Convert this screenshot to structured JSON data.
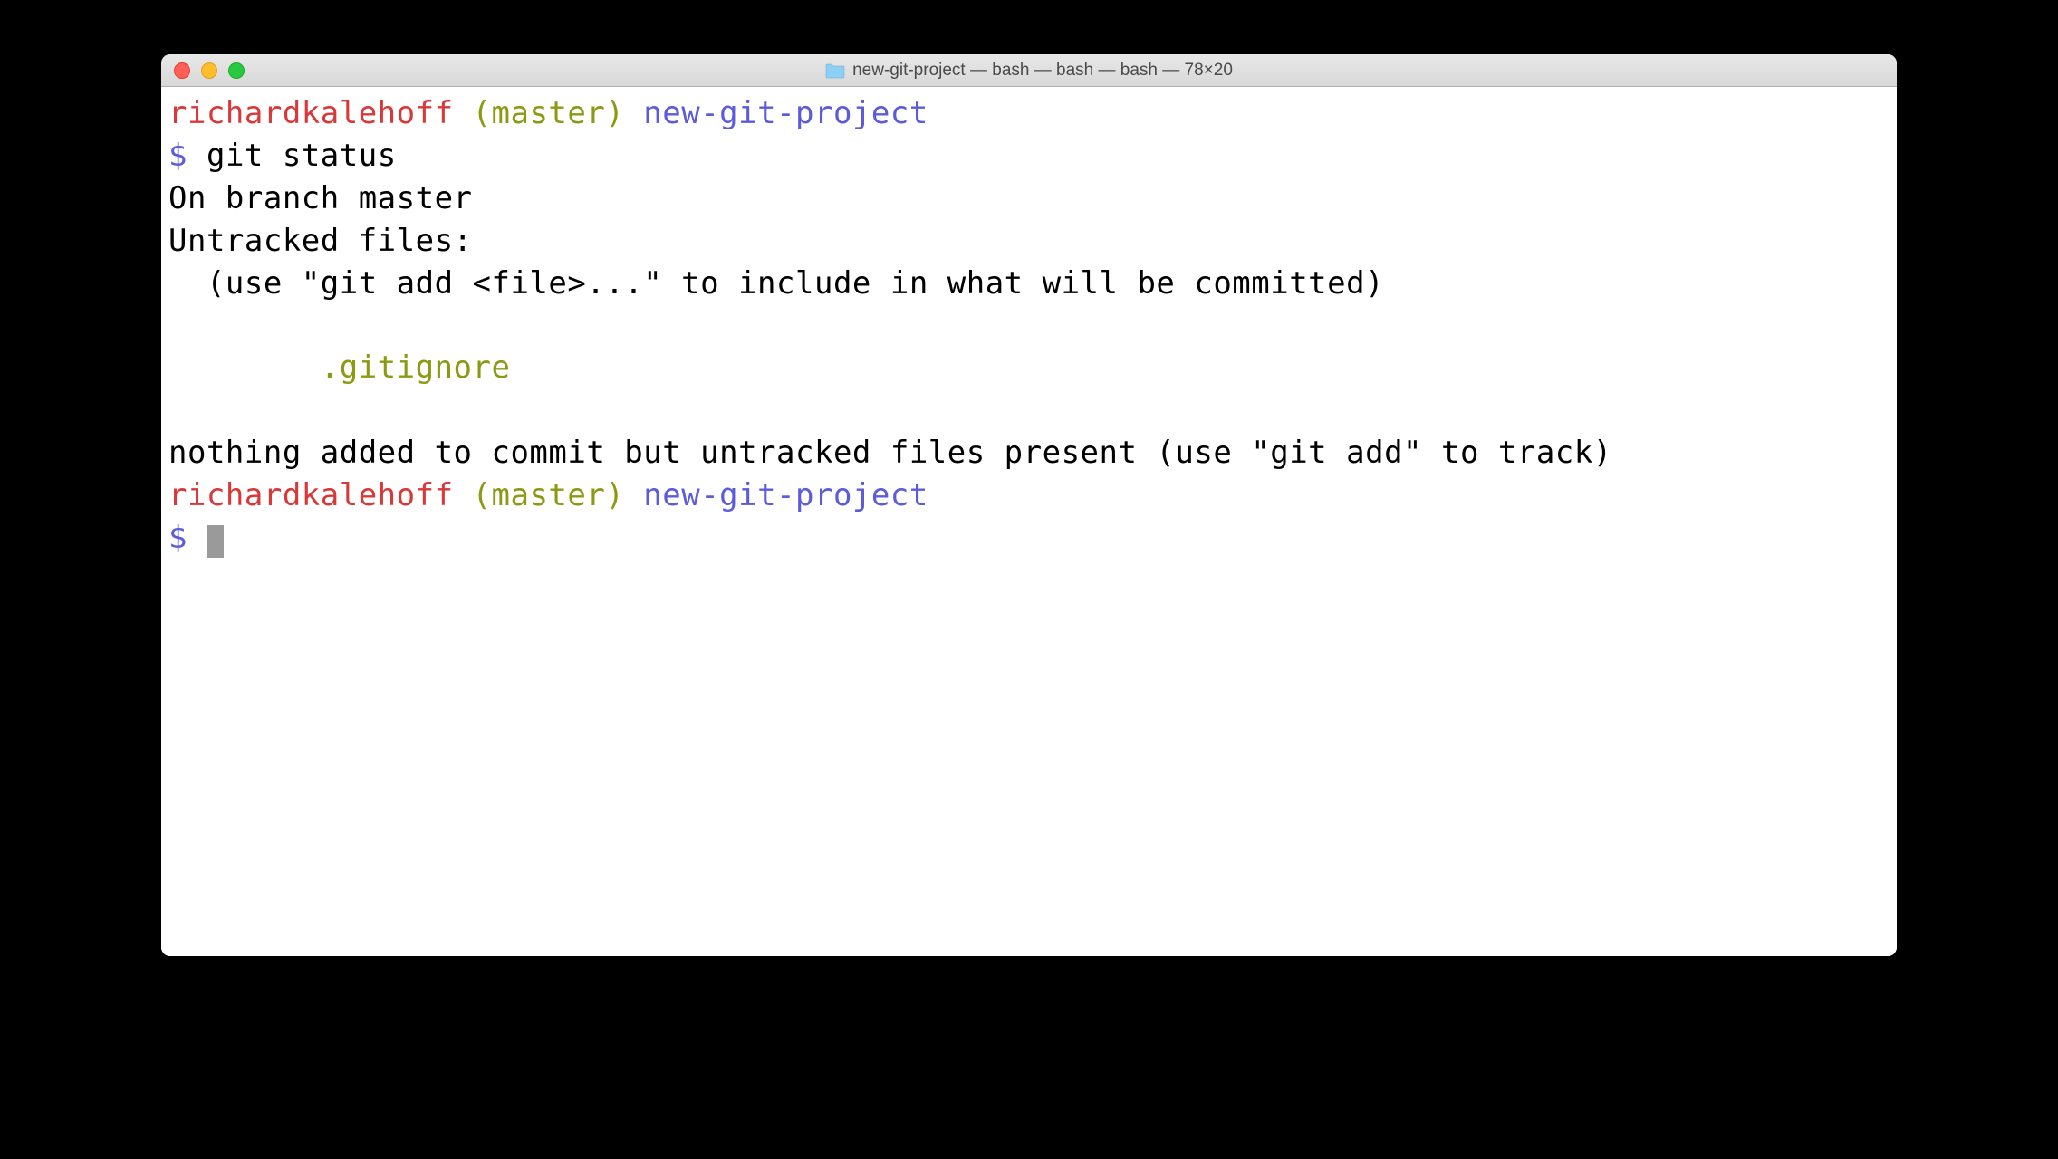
{
  "window": {
    "title": "new-git-project — bash — bash — bash — 78×20"
  },
  "prompt1": {
    "user": "richardkalehoff",
    "branch": "(master)",
    "dir": "new-git-project",
    "symbol": "$",
    "command": "git status"
  },
  "output": {
    "line1": "On branch master",
    "line2": "Untracked files:",
    "line3": "  (use \"git add <file>...\" to include in what will be committed)",
    "blank1": "",
    "untracked1": "        .gitignore",
    "blank2": "",
    "summary": "nothing added to commit but untracked files present (use \"git add\" to track)"
  },
  "prompt2": {
    "user": "richardkalehoff",
    "branch": "(master)",
    "dir": "new-git-project",
    "symbol": "$"
  }
}
